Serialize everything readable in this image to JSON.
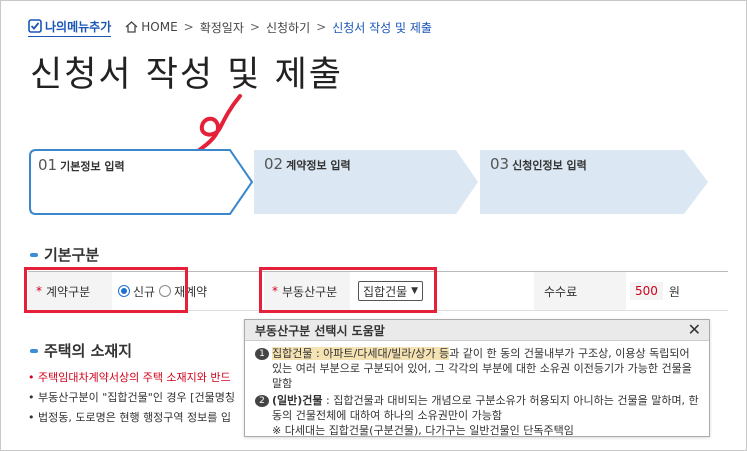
{
  "nav": {
    "my_menu_add": "나의메뉴추가",
    "breadcrumb": {
      "home": "HOME",
      "sep": ">",
      "items": [
        "확정일자",
        "신청하기",
        "신청서 작성 및 제출"
      ]
    }
  },
  "page": {
    "title": "신청서 작성 및 제출"
  },
  "steps": [
    {
      "num": "01",
      "label": "기본정보 입력",
      "state": "active"
    },
    {
      "num": "02",
      "label": "계약정보 입력",
      "state": "inactive"
    },
    {
      "num": "03",
      "label": "신청인정보 입력",
      "state": "inactive"
    }
  ],
  "section_basic": {
    "title": "기본구분"
  },
  "form": {
    "contract_type": {
      "label": "계약구분",
      "required_mark": "*",
      "options": [
        "신규",
        "재계약"
      ],
      "selected": "신규"
    },
    "property_type": {
      "label": "부동산구분",
      "required_mark": "*",
      "value": "집합건물",
      "chevron": "⌄"
    },
    "fee": {
      "label": "수수료",
      "value": "500",
      "unit": "원"
    }
  },
  "section_location": {
    "title": "주택의 소재지"
  },
  "location_notes": [
    "주택임대차계약서상의 주택 소재지와 반드",
    "부동산구분이 \"집합건물\"인 경우 [건물명칭",
    "법정동, 도로명은 현행 행정구역 정보를 입"
  ],
  "popup": {
    "title": "부동산구분 선택시 도움말",
    "close": "✕",
    "items": [
      {
        "num": "1",
        "term": "집합건물 : 아파트/다세대/빌라/상가 등",
        "text": "과 같이 한 동의 건물내부가 구조상, 이용상 독립되어 있는 여러 부분으로 구분되어 있어, 그 각각의 부분에 대한 소유권 이전등기가 가능한 건물을 말함"
      },
      {
        "num": "2",
        "term": "(일반)건물",
        "text": " : 집합건물과 대비되는 개념으로 구분소유가 허용되지 아니하는 건물을 말하며, 한 동의 건물전체에 대하여 하나의 소유권만이 가능함",
        "note": "※ 다세대는 집합건물(구분건물), 다가구는 일반건물인 단독주택임"
      }
    ]
  },
  "colors": {
    "accent": "#1a56b8",
    "annotation_red": "#e5213a",
    "step_active_border": "#3a87cc",
    "step_inactive_fill": "#dbe7f3"
  }
}
